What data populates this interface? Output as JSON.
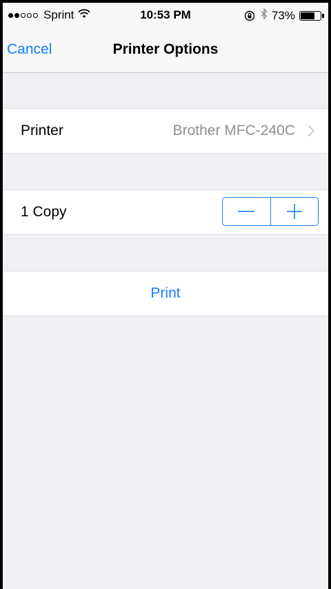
{
  "status_bar": {
    "signal_bars_on": 2,
    "signal_bars_total": 5,
    "carrier": "Sprint",
    "wifi_icon": "wifi-icon",
    "time": "10:53 PM",
    "rotation_lock_icon": "rotation-lock-icon",
    "bluetooth_icon": "bluetooth-icon",
    "battery_percent": "73%",
    "battery_level": 0.73
  },
  "nav": {
    "cancel_label": "Cancel",
    "title": "Printer Options"
  },
  "printer_row": {
    "label": "Printer",
    "value": "Brother MFC-240C",
    "chevron_icon": "chevron-right-icon"
  },
  "copies_row": {
    "label": "1 Copy",
    "minus_icon": "minus-icon",
    "plus_icon": "plus-icon"
  },
  "print_button": {
    "label": "Print"
  },
  "colors": {
    "accent": "#147efb",
    "background": "#efeff4",
    "secondary_text": "#8e8e93"
  }
}
